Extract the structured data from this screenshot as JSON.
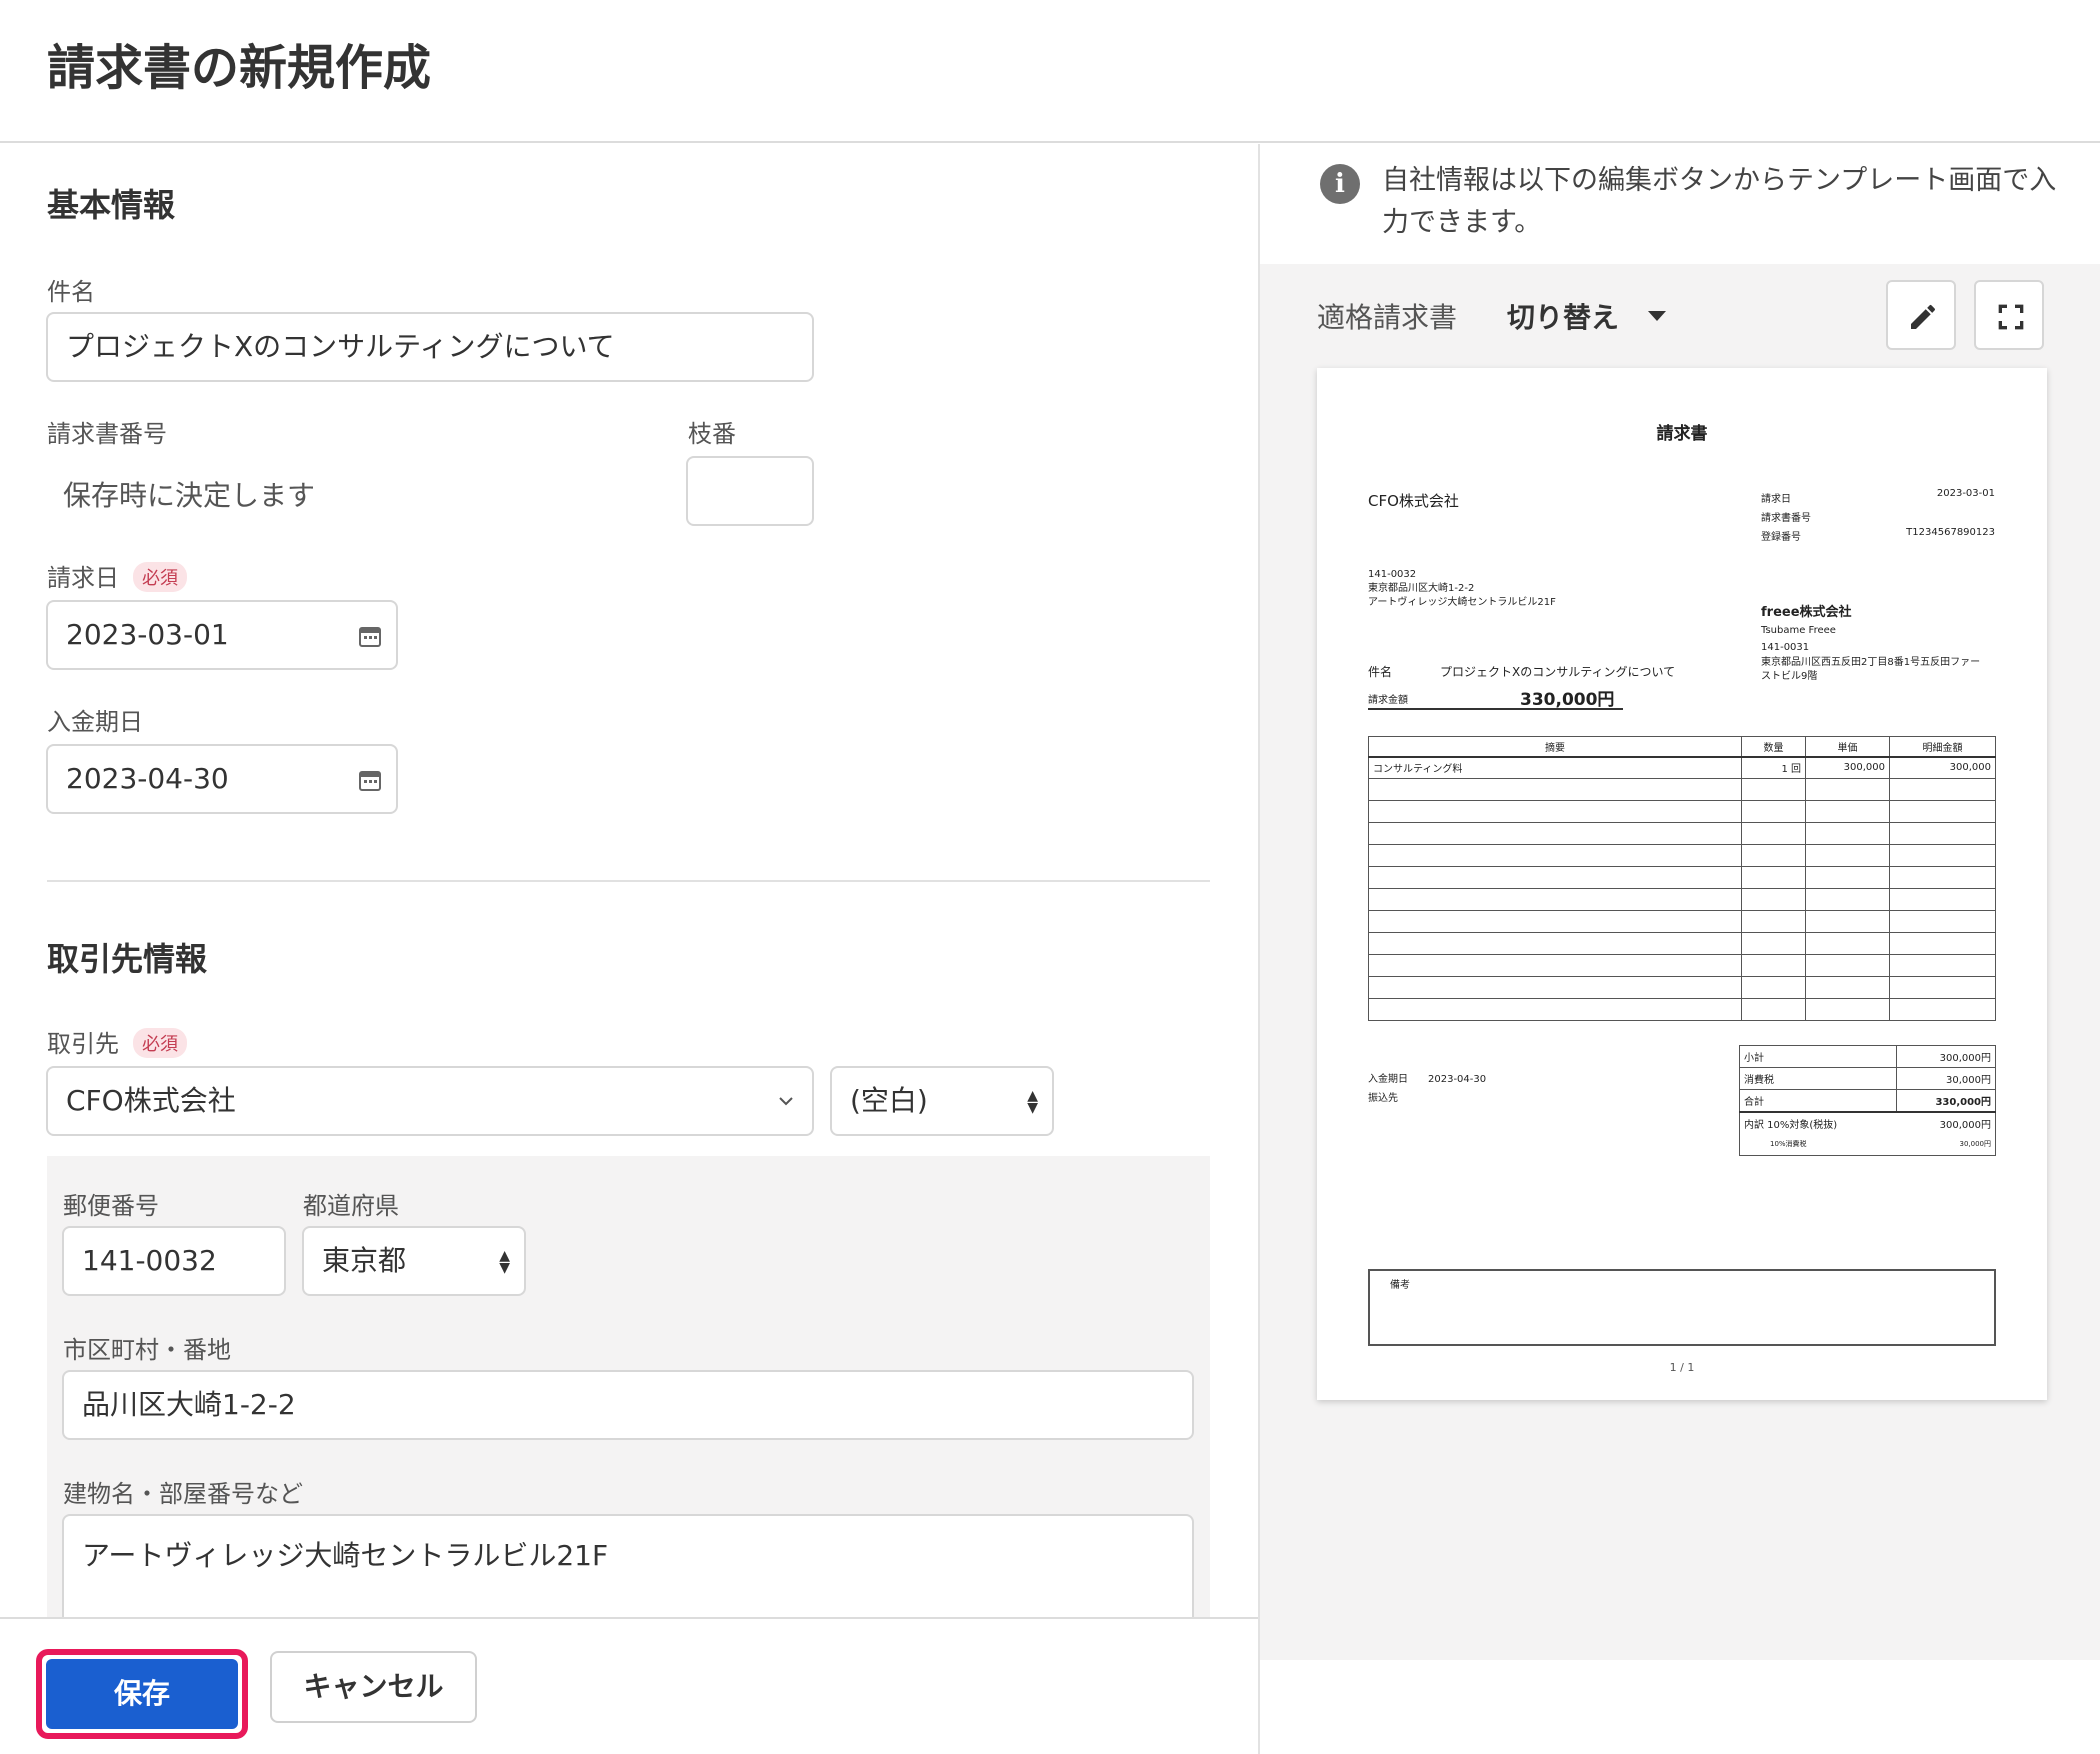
{
  "page_title": "請求書の新規作成",
  "basic": {
    "section_title": "基本情報",
    "subject_label": "件名",
    "subject_value": "プロジェクトXのコンサルティングについて",
    "number_label": "請求書番号",
    "number_value": "保存時に決定します",
    "branch_label": "枝番",
    "branch_value": "",
    "date_label": "請求日",
    "required": "必須",
    "date_value": "2023-03-01",
    "due_label": "入金期日",
    "due_value": "2023-04-30"
  },
  "client": {
    "section_title": "取引先情報",
    "label": "取引先",
    "required": "必須",
    "name": "CFO株式会社",
    "honorific": "(空白)",
    "postal_label": "郵便番号",
    "postal_value": "141-0032",
    "pref_label": "都道府県",
    "pref_value": "東京都",
    "city_label": "市区町村・番地",
    "city_value": "品川区大崎1-2-2",
    "building_label": "建物名・部屋番号など",
    "building_value": "アートヴィレッジ大崎セントラルビル21F"
  },
  "footer": {
    "save": "保存",
    "cancel": "キャンセル"
  },
  "info": {
    "text": "自社情報は以下の編集ボタンからテンプレート画面で入力できます。"
  },
  "preview": {
    "type_label": "適格請求書",
    "switch_label": "切り替え",
    "icons": {
      "edit": "pencil-icon",
      "expand": "fullscreen-icon"
    }
  },
  "invoice": {
    "title": "請求書",
    "client_name": "CFO株式会社",
    "meta_date_label": "請求日",
    "meta_date_value": "2023-03-01",
    "meta_number_label": "請求書番号",
    "meta_reg_label": "登録番号",
    "meta_reg_value": "T1234567890123",
    "client_postal": "141-0032",
    "client_addr1": "東京都品川区大崎1-2-2",
    "client_addr2": "アートヴィレッジ大崎セントラルビル21F",
    "issuer_name": "freee株式会社",
    "issuer_person": "Tsubame Freee",
    "issuer_postal": "141-0031",
    "issuer_addr1": "東京都品川区西五反田2丁目8番1号五反田ファー",
    "issuer_addr2": "ストビル9階",
    "subject_label": "件名",
    "subject_value": "プロジェクトXのコンサルティングについて",
    "amount_label": "請求金額",
    "amount_value": "330,000円",
    "columns": [
      "摘要",
      "数量",
      "単価",
      "明細金額"
    ],
    "rows": [
      {
        "desc": "コンサルティング料",
        "qty": "1 回",
        "price": "300,000",
        "amount": "300,000"
      }
    ],
    "empty_rows": 11,
    "pay_due_label": "入金期日",
    "pay_due_value": "2023-04-30",
    "bank_label": "振込先",
    "subtotal_label": "小計",
    "subtotal": "300,000円",
    "tax_label": "消費税",
    "tax": "30,000円",
    "total_label": "合計",
    "total": "330,000円",
    "breakdown_label": "内訳 10%対象(税抜)",
    "breakdown": "300,000円",
    "breakdown_tax_label": "10%消費税",
    "breakdown_tax": "30,000円",
    "remarks_label": "備考",
    "page": "1 / 1"
  }
}
